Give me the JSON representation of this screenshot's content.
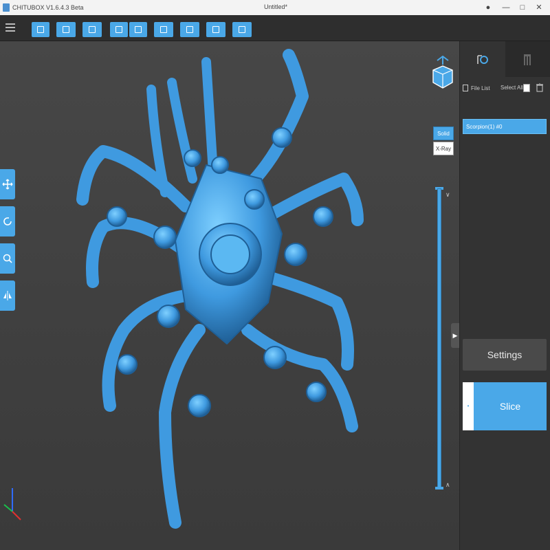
{
  "window": {
    "app_name": "CHITUBOX V1.6.4.3 Beta",
    "document_title": "Untitled*",
    "controls": [
      "user-icon",
      "minimize-icon",
      "maximize-icon",
      "close-icon"
    ]
  },
  "toolbar": {
    "tools": [
      {
        "icon": "open-file-icon"
      },
      {
        "icon": "save-icon"
      },
      {
        "icon": "undo-icon"
      },
      {
        "icon": "copy-icon"
      },
      {
        "icon": "paste-icon"
      },
      {
        "icon": "auto-layout-icon"
      },
      {
        "icon": "support-icon"
      },
      {
        "icon": "hollow-icon"
      },
      {
        "icon": "export-icon"
      }
    ]
  },
  "left_tools": [
    "move-icon",
    "rotate-icon",
    "scale-icon",
    "mirror-icon"
  ],
  "render_mode": {
    "solid_label": "Solid",
    "xray_label": "X-Ray",
    "active": "Solid"
  },
  "panel": {
    "tabs": [
      "model-tab-icon",
      "support-tab-icon"
    ],
    "file_list_label": "File List",
    "select_all_label": "Select All",
    "files": [
      {
        "name": "Scorpion(1) #0"
      }
    ],
    "settings_label": "Settings",
    "slice_label": "Slice"
  },
  "colors": {
    "accent": "#4aa8e8",
    "viewport_bg": "#444444",
    "panel_bg": "#333333"
  }
}
